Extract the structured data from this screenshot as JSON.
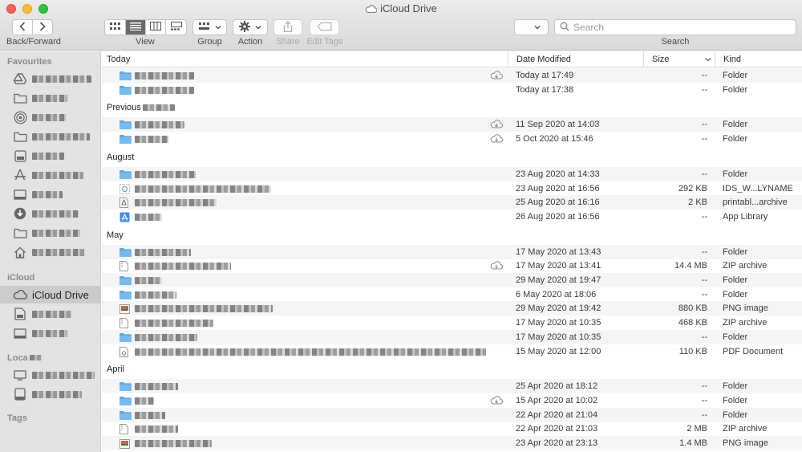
{
  "window": {
    "title": "iCloud Drive"
  },
  "toolbar": {
    "back_forward_label": "Back/Forward",
    "view_label": "View",
    "group_label": "Group",
    "action_label": "Action",
    "share_label": "Share",
    "edit_tags_label": "Edit Tags",
    "search_label": "Search",
    "search_placeholder": "Search"
  },
  "sidebar": {
    "favourites_header": "Favourites",
    "icloud_header": "iCloud",
    "locations_header": "Loca",
    "tags_header": "Tags",
    "icloud_drive_label": "iCloud Drive",
    "favourites": [
      {
        "icon": "google-drive-icon",
        "redacted": true
      },
      {
        "icon": "folder-icon",
        "redacted": true
      },
      {
        "icon": "airdrop-icon",
        "redacted": true
      },
      {
        "icon": "folder-icon",
        "redacted": true
      },
      {
        "icon": "documents-icon",
        "redacted": true
      },
      {
        "icon": "applications-icon",
        "redacted": true
      },
      {
        "icon": "desktop-icon",
        "redacted": true
      },
      {
        "icon": "downloads-icon",
        "redacted": true
      },
      {
        "icon": "folder-icon",
        "redacted": true
      },
      {
        "icon": "home-icon",
        "redacted": true
      }
    ],
    "icloud_items": [
      {
        "icon": "document-icon",
        "redacted": true
      },
      {
        "icon": "desktop-icon",
        "redacted": true
      }
    ],
    "locations": [
      {
        "icon": "computer-icon",
        "redacted": true
      },
      {
        "icon": "disk-icon",
        "redacted": true
      }
    ]
  },
  "columns": {
    "name": "Today",
    "date_modified": "Date Modified",
    "size": "Size",
    "kind": "Kind"
  },
  "groups": [
    {
      "title": "",
      "rows": [
        {
          "icon": "folder-icon",
          "cloud": true,
          "date": "Today at 17:49",
          "size": "--",
          "kind": "Folder"
        },
        {
          "icon": "folder-icon",
          "cloud": false,
          "date": "Today at 17:38",
          "size": "--",
          "kind": "Folder"
        }
      ]
    },
    {
      "title": "Previous",
      "rows": [
        {
          "icon": "folder-icon",
          "cloud": true,
          "date": "11 Sep 2020 at 14:03",
          "size": "--",
          "kind": "Folder"
        },
        {
          "icon": "folder-icon",
          "cloud": true,
          "date": "5 Oct 2020 at 15:46",
          "size": "--",
          "kind": "Folder"
        }
      ]
    },
    {
      "title": "August",
      "rows": [
        {
          "icon": "folder-icon",
          "cloud": false,
          "date": "23 Aug 2020 at 14:33",
          "size": "--",
          "kind": "Folder"
        },
        {
          "icon": "settings-file-icon",
          "cloud": false,
          "date": "23 Aug 2020 at 16:56",
          "size": "292 KB",
          "kind": "IDS_W...LYNAME"
        },
        {
          "icon": "archive-icon",
          "cloud": false,
          "date": "25 Aug 2020 at 16:16",
          "size": "2 KB",
          "kind": "printabl...archive"
        },
        {
          "icon": "app-library-icon",
          "cloud": false,
          "date": "26 Aug 2020 at 16:56",
          "size": "--",
          "kind": "App Library"
        }
      ]
    },
    {
      "title": "May",
      "rows": [
        {
          "icon": "folder-icon",
          "cloud": false,
          "date": "17 May 2020 at 13:43",
          "size": "--",
          "kind": "Folder"
        },
        {
          "icon": "zip-icon",
          "cloud": true,
          "date": "17 May 2020 at 13:41",
          "size": "14.4 MB",
          "kind": "ZIP archive"
        },
        {
          "icon": "folder-icon",
          "cloud": false,
          "date": "29 May 2020 at 19:47",
          "size": "--",
          "kind": "Folder"
        },
        {
          "icon": "folder-icon",
          "cloud": false,
          "date": "6 May 2020 at 18:06",
          "size": "--",
          "kind": "Folder"
        },
        {
          "icon": "image-icon",
          "cloud": false,
          "date": "29 May 2020 at 19:42",
          "size": "880 KB",
          "kind": "PNG image"
        },
        {
          "icon": "zip-icon",
          "cloud": false,
          "date": "17 May 2020 at 10:35",
          "size": "468 KB",
          "kind": "ZIP archive"
        },
        {
          "icon": "folder-icon",
          "cloud": false,
          "date": "17 May 2020 at 10:35",
          "size": "--",
          "kind": "Folder"
        },
        {
          "icon": "pdf-icon",
          "cloud": false,
          "date": "15 May 2020 at 12:00",
          "size": "110 KB",
          "kind": "PDF Document"
        }
      ]
    },
    {
      "title": "April",
      "rows": [
        {
          "icon": "folder-icon",
          "cloud": false,
          "date": "25 Apr 2020 at 18:12",
          "size": "--",
          "kind": "Folder"
        },
        {
          "icon": "folder-icon",
          "cloud": true,
          "date": "15 Apr 2020 at 10:02",
          "size": "--",
          "kind": "Folder"
        },
        {
          "icon": "folder-icon",
          "cloud": false,
          "date": "22 Apr 2020 at 21:04",
          "size": "--",
          "kind": "Folder"
        },
        {
          "icon": "zip-icon",
          "cloud": false,
          "date": "22 Apr 2020 at 21:03",
          "size": "2 MB",
          "kind": "ZIP archive"
        },
        {
          "icon": "image-icon",
          "cloud": false,
          "date": "23 Apr 2020 at 23:13",
          "size": "1.4 MB",
          "kind": "PNG image"
        }
      ]
    }
  ],
  "colors": {
    "folder": "#5aa9e6",
    "selection": "#cbcbcb",
    "accent": "#0a84ff"
  }
}
